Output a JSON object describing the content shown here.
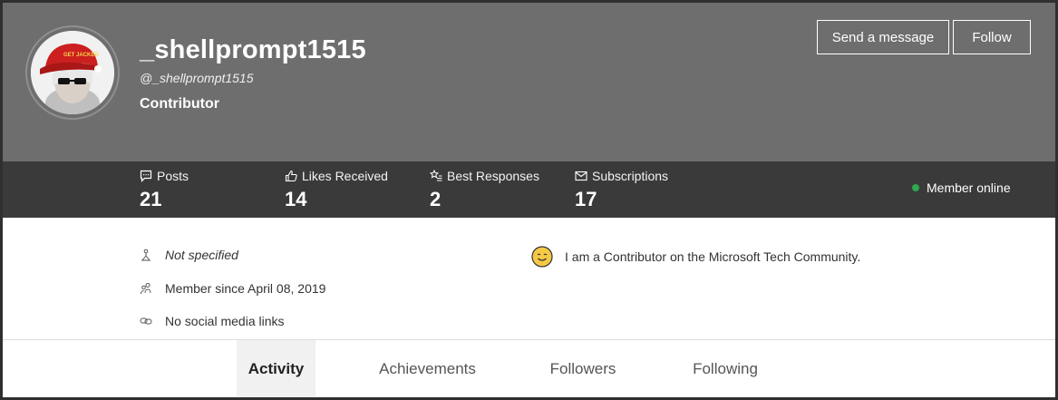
{
  "profile": {
    "username": "_shellprompt1515",
    "handle": "@_shellprompt1515",
    "rank": "Contributor",
    "avatar_cap_text": "GET JACKED"
  },
  "actions": {
    "message_label": "Send a message",
    "follow_label": "Follow"
  },
  "stats": [
    {
      "label": "Posts",
      "value": "21",
      "icon": "speech-bubble-icon"
    },
    {
      "label": "Likes Received",
      "value": "14",
      "icon": "thumbs-up-icon"
    },
    {
      "label": "Best Responses",
      "value": "2",
      "icon": "star-list-icon"
    },
    {
      "label": "Subscriptions",
      "value": "17",
      "icon": "envelope-icon"
    }
  ],
  "status": {
    "online_label": "Member online",
    "online_color": "#2fa84f"
  },
  "info": {
    "location": "Not specified",
    "member_since": "Member since April 08, 2019",
    "social": "No social media links",
    "bio": "I am a Contributor on the Microsoft Tech Community."
  },
  "tabs": [
    {
      "label": "Activity",
      "active": true
    },
    {
      "label": "Achievements",
      "active": false
    },
    {
      "label": "Followers",
      "active": false
    },
    {
      "label": "Following",
      "active": false
    }
  ],
  "colors": {
    "hero_bg": "#6e6e6e",
    "stats_bg": "#3a3a3a"
  }
}
